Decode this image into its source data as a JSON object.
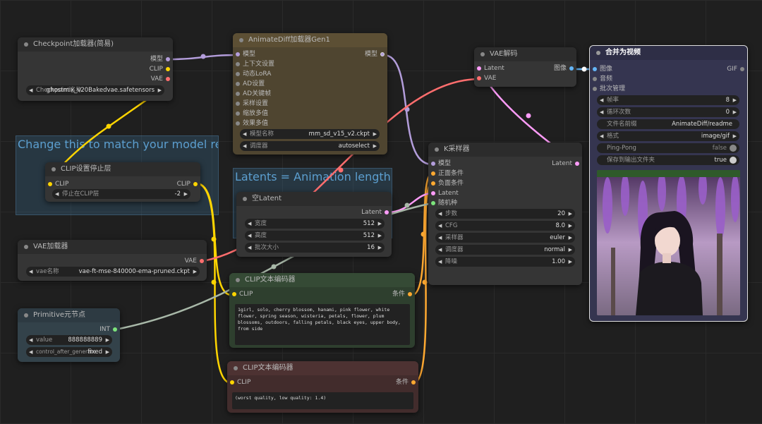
{
  "groups": {
    "model": {
      "title": "Change this to match your model reqs"
    },
    "latents": {
      "title": "Latents = Animation length"
    }
  },
  "checkpoint": {
    "title": "Checkpoint加载器(简易)",
    "outputs": [
      "模型",
      "CLIP",
      "VAE"
    ],
    "ckpt_label": "Checkpoint名称",
    "ckpt_value": "ghostmix_v20Bakedvae.safetensors"
  },
  "clip_skip": {
    "title": "CLIP设置停止层",
    "input": "CLIP",
    "output": "CLIP",
    "layer_label": "停止在CLIP层",
    "layer_value": "-2"
  },
  "vae_loader": {
    "title": "VAE加载器",
    "output": "VAE",
    "vae_label": "vae名称",
    "vae_value": "vae-ft-mse-840000-ema-pruned.ckpt"
  },
  "primitive": {
    "title": "Primitive元节点",
    "output": "INT",
    "value_label": "value",
    "value_value": "888888889",
    "cag_label": "control_after_generate",
    "cag_value": "fixed"
  },
  "animatediff": {
    "title": "AnimateDiff加载器Gen1",
    "inputs": [
      "模型",
      "上下文设置",
      "动态LoRA",
      "AD设置",
      "AD关键帧",
      "采样设置",
      "缩放多值",
      "效果多值"
    ],
    "output": "模型",
    "model_label": "模型名称",
    "model_value": "mm_sd_v15_v2.ckpt",
    "sched_label": "调度器",
    "sched_value": "autoselect"
  },
  "empty_latent": {
    "title": "空Latent",
    "output": "Latent",
    "width_label": "宽度",
    "width_value": "512",
    "height_label": "高度",
    "height_value": "512",
    "batch_label": "批次大小",
    "batch_value": "16"
  },
  "clip_pos": {
    "title": "CLIP文本编码器",
    "input": "CLIP",
    "output": "条件",
    "text": "1girl, solo, cherry blossom, hanami, pink flower, white flower, spring season, wisteria, petals, flower, plum blossoms, outdoors, falling petals, black eyes, upper body, from side"
  },
  "clip_neg": {
    "title": "CLIP文本编码器",
    "input": "CLIP",
    "output": "条件",
    "text": "(worst quality, low quality: 1.4)"
  },
  "vae_decode": {
    "title": "VAE解码",
    "inputs": [
      "Latent",
      "VAE"
    ],
    "output": "图像"
  },
  "ksampler": {
    "title": "K采样器",
    "inputs": [
      "模型",
      "正面条件",
      "负面条件",
      "Latent",
      "随机种"
    ],
    "output": "Latent",
    "steps_label": "步数",
    "steps_value": "20",
    "cfg_label": "CFG",
    "cfg_value": "8.0",
    "sampler_label": "采样器",
    "sampler_value": "euler",
    "scheduler_label": "调度器",
    "scheduler_value": "normal",
    "denoise_label": "降噪",
    "denoise_value": "1.00"
  },
  "video_combine": {
    "title": "合并为视频",
    "inputs": [
      "图像",
      "音频",
      "批次管理"
    ],
    "output": "GIF",
    "fps_label": "帧率",
    "fps_value": "8",
    "loop_label": "循环次数",
    "loop_value": "0",
    "prefix_label": "文件名前缀",
    "prefix_value": "AnimateDiff/readme",
    "format_label": "格式",
    "format_value": "image/gif",
    "pingpong_label": "Ping-Pong",
    "pingpong_value": "false",
    "save_label": "保存到输出文件夹",
    "save_value": "true"
  },
  "colors": {
    "model": "#b39ddb",
    "clip": "#ffd500",
    "vae": "#ff6e6e",
    "latent": "#ff9cf9",
    "conditioning": "#ffa931",
    "image": "#64b5f6",
    "int": "#7ce47c"
  }
}
